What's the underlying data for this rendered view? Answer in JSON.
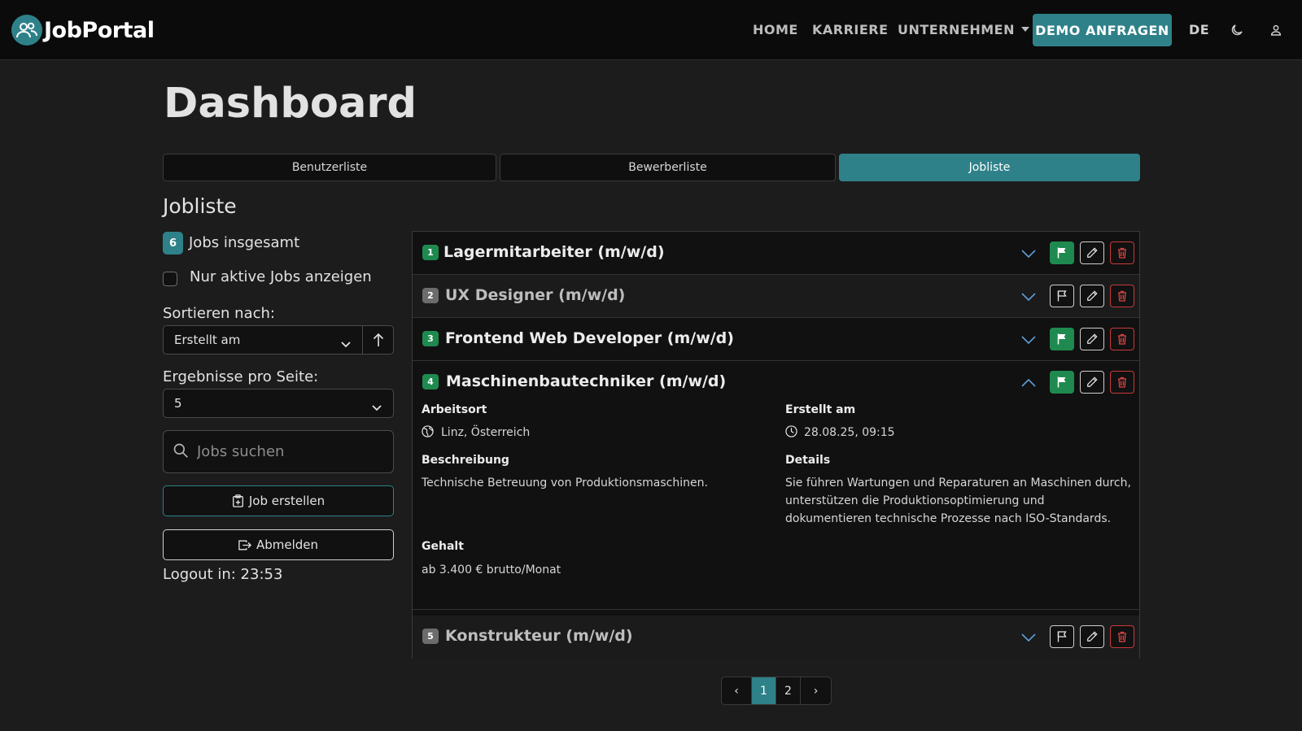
{
  "nav": {
    "brand": "JobPortal",
    "links": [
      {
        "label": "HOME"
      },
      {
        "label": "KARRIERE"
      },
      {
        "label": "UNTERNEHMEN"
      }
    ],
    "cta": "DEMO ANFRAGEN",
    "language": "DE",
    "icons": [
      "moon-icon",
      "user-icon"
    ]
  },
  "page": {
    "title": "Dashboard",
    "tabs": [
      {
        "label": "Benutzerliste",
        "active": false
      },
      {
        "label": "Bewerberliste",
        "active": false
      },
      {
        "label": "Jobliste",
        "active": true
      }
    ],
    "section_title": "Jobliste"
  },
  "sidebar": {
    "total_count": "6",
    "total_label": "Jobs insgesamt",
    "only_active_label": "Nur aktive Jobs anzeigen",
    "sort_label": "Sortieren nach:",
    "sort_value": "Erstellt am",
    "per_page_label": "Ergebnisse pro Seite:",
    "per_page_value": "5",
    "search_placeholder": "Jobs suchen",
    "create_label": "Job erstellen",
    "logout_label": "Abmelden",
    "logout_timer": "Logout in: 23:53"
  },
  "jobs": [
    {
      "num": "1",
      "title": "Lagermitarbeiter (m/w/d)",
      "active": true,
      "expanded": false
    },
    {
      "num": "2",
      "title": "UX Designer (m/w/d)",
      "active": false,
      "expanded": false
    },
    {
      "num": "3",
      "title": "Frontend Web Developer (m/w/d)",
      "active": true,
      "expanded": false
    },
    {
      "num": "4",
      "title": "Maschinenbautechniker (m/w/d)",
      "active": true,
      "expanded": true
    },
    {
      "num": "5",
      "title": "Konstrukteur (m/w/d)",
      "active": false,
      "expanded": false
    }
  ],
  "expanded_job": {
    "location_label": "Arbeitsort",
    "location": "Linz, Österreich",
    "created_label": "Erstellt am",
    "created": "28.08.25, 09:15",
    "description_label": "Beschreibung",
    "description": "Technische Betreuung von Produktionsmaschinen.",
    "details_label": "Details",
    "details": "Sie führen Wartungen und Reparaturen an Maschinen durch, unterstützen die Produktionsoptimierung und dokumentieren technische Prozesse nach ISO-Standards.",
    "salary_label": "Gehalt",
    "salary": "ab 3.400 € brutto/Monat"
  },
  "pagination": {
    "prev": "‹",
    "pages": [
      "1",
      "2"
    ],
    "current": "1",
    "next": "›"
  },
  "colors": {
    "accent": "#2f8189",
    "active_green": "#1f8a4f",
    "inactive_gray": "#6c6c6c",
    "danger": "#c93a3a"
  }
}
